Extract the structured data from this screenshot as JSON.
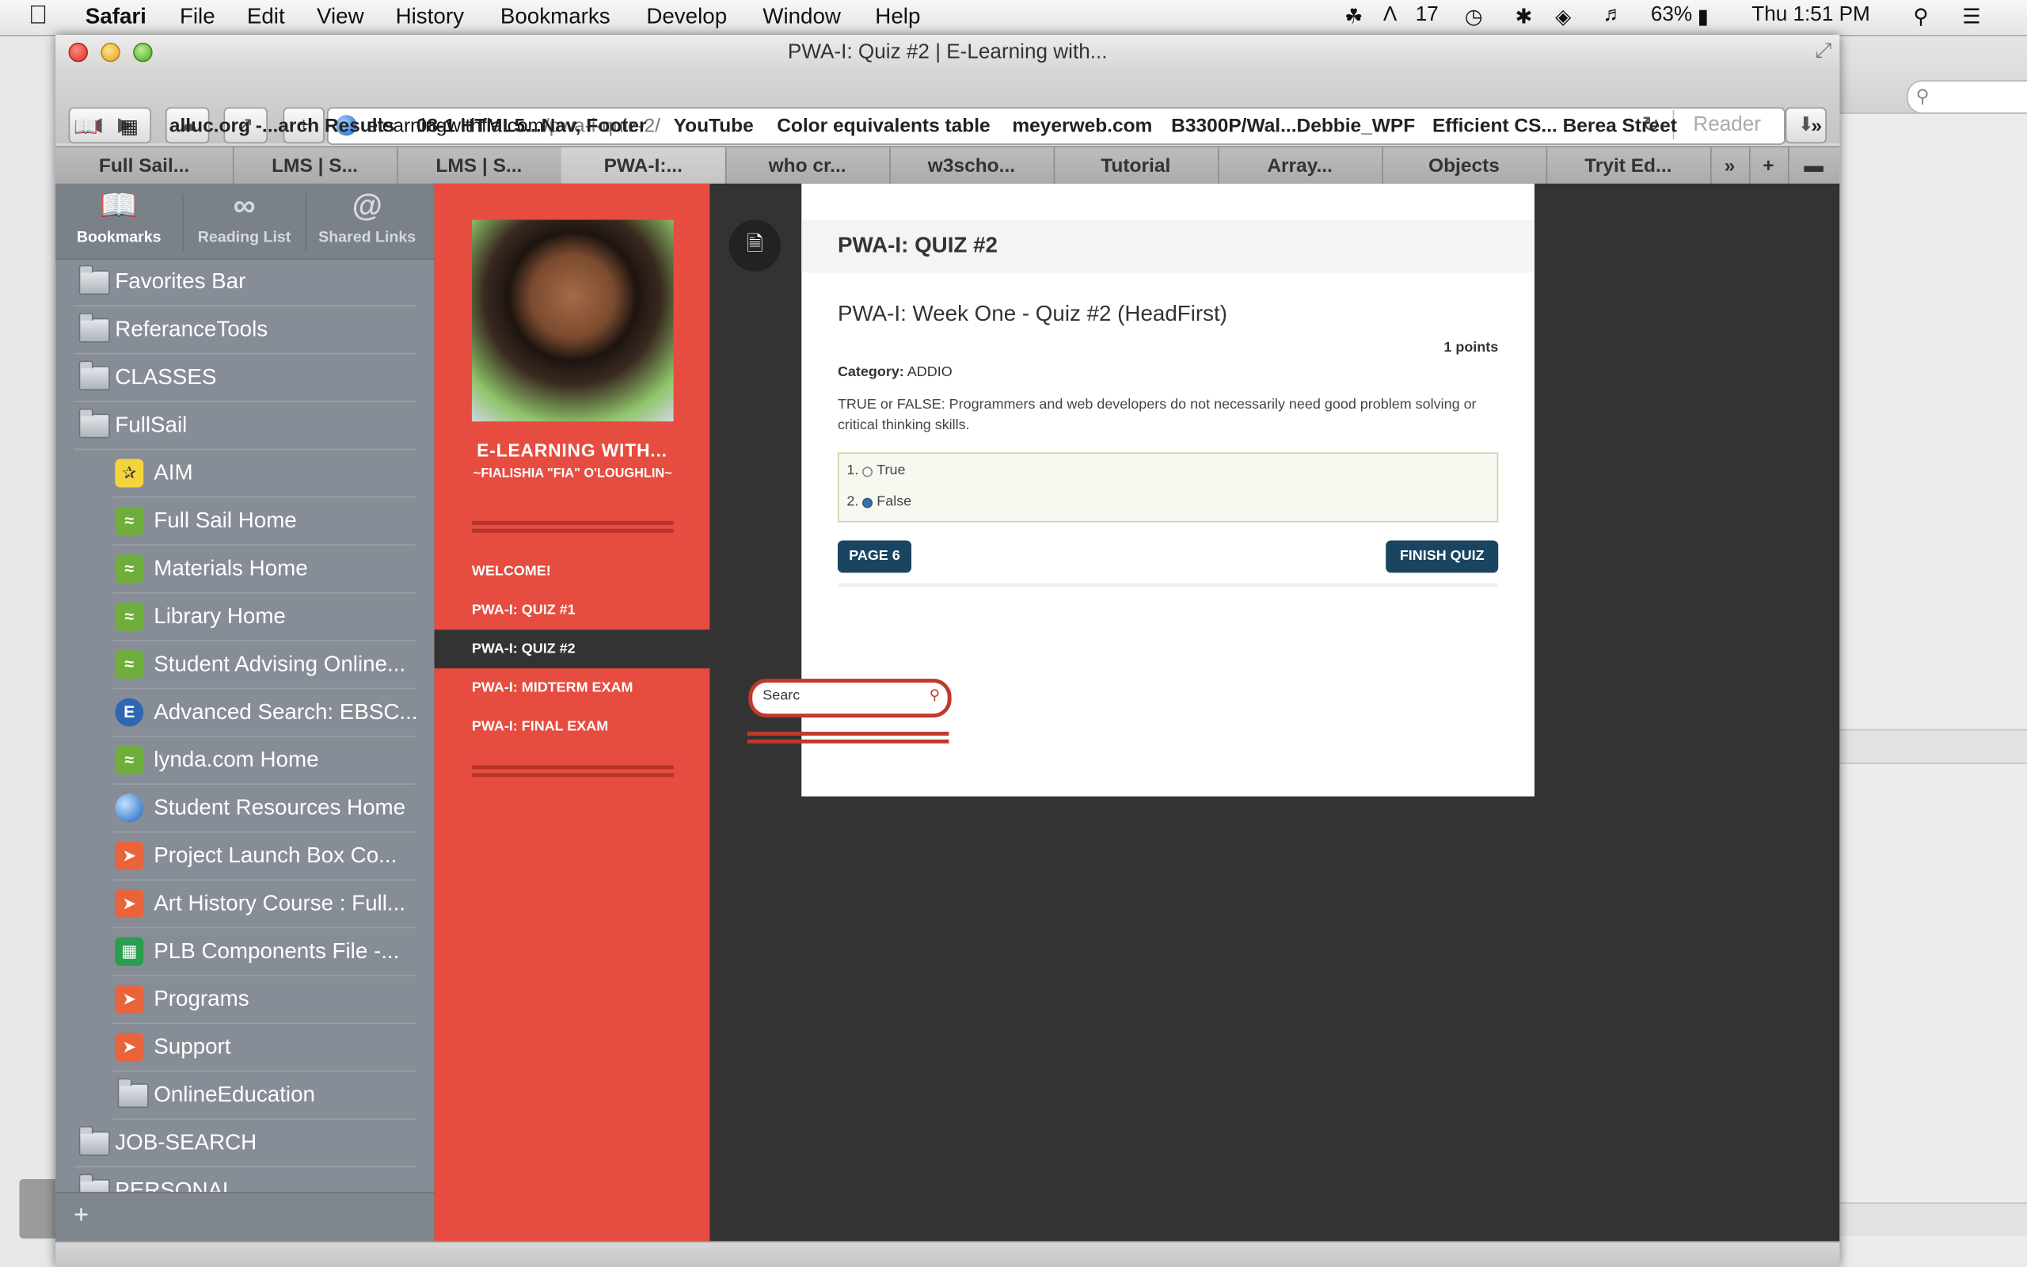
{
  "menubar": {
    "app": "Safari",
    "items": [
      "File",
      "Edit",
      "View",
      "History",
      "Bookmarks",
      "Develop",
      "Window",
      "Help"
    ],
    "status": {
      "adobe_count": "17",
      "battery": "63%",
      "clock": "Thu 1:51 PM"
    }
  },
  "window": {
    "title": "PWA-I: Quiz #2 | E-Learning with...",
    "url_host": "elearningwithfia.com",
    "url_path": "/pwa-i-quiz-2/",
    "reader_label": "Reader"
  },
  "bookmarks_bar": [
    "alluc.org -...arch Results",
    "08-1 HTML5...Nav, Footer",
    "YouTube",
    "Color equivalents table",
    "meyerweb.com",
    "B3300P/Wal...Debbie_WPF",
    "Efficient CS... Berea Street"
  ],
  "tabs": [
    "Full Sail...",
    "LMS | S...",
    "LMS | S...",
    "PWA-I:...",
    "who cr...",
    "w3scho...",
    "Tutorial",
    "Array...",
    "Objects",
    "Tryit Ed..."
  ],
  "active_tab": 3,
  "sidebar": {
    "header": [
      {
        "icon": "book-icon",
        "label": "Bookmarks"
      },
      {
        "icon": "glasses-icon",
        "label": "Reading List"
      },
      {
        "icon": "at-icon",
        "label": "Shared Links"
      }
    ],
    "items": [
      {
        "label": "Favorites Bar",
        "icon": "folder-icon",
        "indent": 0
      },
      {
        "label": "ReferanceTools",
        "icon": "folder-icon",
        "indent": 0
      },
      {
        "label": "CLASSES",
        "icon": "folder-icon",
        "indent": 0
      },
      {
        "label": "FullSail",
        "icon": "folder-icon",
        "indent": 0
      },
      {
        "label": "AIM",
        "icon": "aim-icon",
        "indent": 1
      },
      {
        "label": "Full Sail Home",
        "icon": "webpage-icon",
        "indent": 1
      },
      {
        "label": "Materials Home",
        "icon": "webpage-icon",
        "indent": 1
      },
      {
        "label": "Library Home",
        "icon": "webpage-icon",
        "indent": 1
      },
      {
        "label": "Student Advising Online...",
        "icon": "webpage-icon",
        "indent": 1
      },
      {
        "label": "Advanced Search: EBSC...",
        "icon": "ebsco-icon",
        "indent": 1
      },
      {
        "label": "lynda.com Home",
        "icon": "webpage-icon",
        "indent": 1
      },
      {
        "label": "Student Resources Home",
        "icon": "globe-icon",
        "indent": 1
      },
      {
        "label": "Project Launch Box Co...",
        "icon": "launch-icon",
        "indent": 1
      },
      {
        "label": "Art History Course : Full...",
        "icon": "launch-icon",
        "indent": 1
      },
      {
        "label": "PLB Components File -...",
        "icon": "sheet-icon",
        "indent": 1
      },
      {
        "label": "Programs",
        "icon": "launch-icon",
        "indent": 1
      },
      {
        "label": "Support",
        "icon": "launch-icon",
        "indent": 1
      },
      {
        "label": "OnlineEducation",
        "icon": "folder-icon",
        "indent": 1
      },
      {
        "label": "JOB-SEARCH",
        "icon": "folder-icon",
        "indent": 0
      },
      {
        "label": "PERSONAL",
        "icon": "folder-icon",
        "indent": 0
      }
    ]
  },
  "site": {
    "name": "E-LEARNING WITH...",
    "subtitle": "~FIALISHIA \"FIA\" O'LOUGHLIN~",
    "nav": [
      "WELCOME!",
      "PWA-I: QUIZ #1",
      "PWA-I: QUIZ #2",
      "PWA-I: MIDTERM EXAM",
      "PWA-I: FINAL EXAM"
    ],
    "current_nav": 2,
    "search_value": "Searc"
  },
  "quiz": {
    "page_title": "PWA-I: QUIZ #2",
    "question_title": "PWA-I: Week One - Quiz #2 (HeadFirst)",
    "points": "1 points",
    "category_label": "Category:",
    "category": "ADDIO",
    "question": "TRUE or FALSE:  Programmers and web developers do not necessarily need good problem solving or critical thinking skills.",
    "answers": [
      {
        "num": "1.",
        "label": "True",
        "selected": false
      },
      {
        "num": "2.",
        "label": "False",
        "selected": true
      }
    ],
    "page_button": "PAGE 6",
    "finish_button": "FINISH QUIZ"
  },
  "colors": {
    "accent_red": "#e64c3f",
    "button_navy": "#1a4560",
    "sidebar": "#878d96",
    "content_dark": "#333333"
  }
}
